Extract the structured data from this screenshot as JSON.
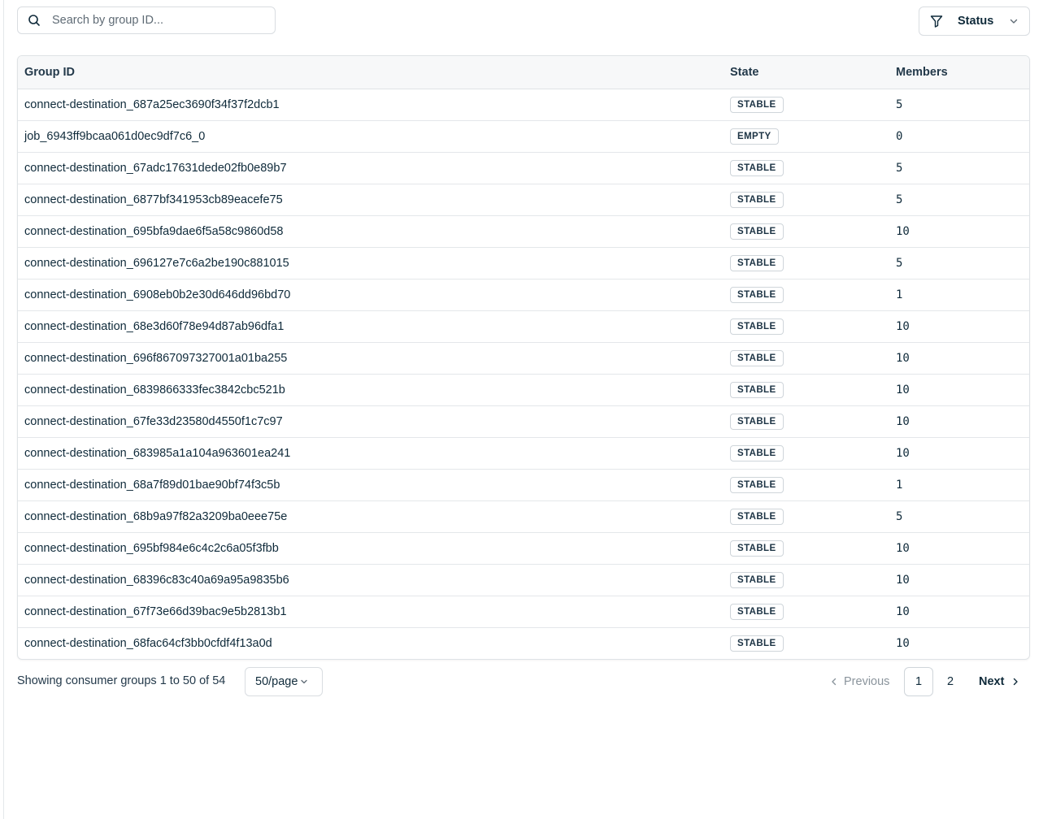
{
  "search": {
    "placeholder": "Search by group ID...",
    "value": ""
  },
  "filter": {
    "label": "Status"
  },
  "table": {
    "headers": {
      "group_id": "Group ID",
      "state": "State",
      "members": "Members"
    },
    "rows": [
      {
        "group_id": "connect-destination_687a25ec3690f34f37f2dcb1",
        "state": "STABLE",
        "members": "5"
      },
      {
        "group_id": "job_6943ff9bcaa061d0ec9df7c6_0",
        "state": "EMPTY",
        "members": "0"
      },
      {
        "group_id": "connect-destination_67adc17631dede02fb0e89b7",
        "state": "STABLE",
        "members": "5"
      },
      {
        "group_id": "connect-destination_6877bf341953cb89eacefe75",
        "state": "STABLE",
        "members": "5"
      },
      {
        "group_id": "connect-destination_695bfa9dae6f5a58c9860d58",
        "state": "STABLE",
        "members": "10"
      },
      {
        "group_id": "connect-destination_696127e7c6a2be190c881015",
        "state": "STABLE",
        "members": "5"
      },
      {
        "group_id": "connect-destination_6908eb0b2e30d646dd96bd70",
        "state": "STABLE",
        "members": "1"
      },
      {
        "group_id": "connect-destination_68e3d60f78e94d87ab96dfa1",
        "state": "STABLE",
        "members": "10"
      },
      {
        "group_id": "connect-destination_696f867097327001a01ba255",
        "state": "STABLE",
        "members": "10"
      },
      {
        "group_id": "connect-destination_6839866333fec3842cbc521b",
        "state": "STABLE",
        "members": "10"
      },
      {
        "group_id": "connect-destination_67fe33d23580d4550f1c7c97",
        "state": "STABLE",
        "members": "10"
      },
      {
        "group_id": "connect-destination_683985a1a104a963601ea241",
        "state": "STABLE",
        "members": "10"
      },
      {
        "group_id": "connect-destination_68a7f89d01bae90bf74f3c5b",
        "state": "STABLE",
        "members": "1"
      },
      {
        "group_id": "connect-destination_68b9a97f82a3209ba0eee75e",
        "state": "STABLE",
        "members": "5"
      },
      {
        "group_id": "connect-destination_695bf984e6c4c2c6a05f3fbb",
        "state": "STABLE",
        "members": "10"
      },
      {
        "group_id": "connect-destination_68396c83c40a69a95a9835b6",
        "state": "STABLE",
        "members": "10"
      },
      {
        "group_id": "connect-destination_67f73e66d39bac9e5b2813b1",
        "state": "STABLE",
        "members": "10"
      },
      {
        "group_id": "connect-destination_68fac64cf3bb0cfdf4f13a0d",
        "state": "STABLE",
        "members": "10"
      }
    ]
  },
  "footer": {
    "showing": "Showing consumer groups 1 to 50 of 54",
    "page_size": "50/page",
    "previous": "Previous",
    "next": "Next",
    "pages": [
      "1",
      "2"
    ],
    "current_page": "1"
  },
  "icons": {
    "search": "search-icon",
    "filter": "filter-icon",
    "dropdown": "chevron-down-icon",
    "prev": "chevron-left-icon",
    "next": "chevron-right-icon"
  },
  "colors": {
    "text": "#0f2a3a",
    "border": "#d9dde1",
    "header_bg": "#f7f8f9",
    "muted": "#8a949c"
  }
}
